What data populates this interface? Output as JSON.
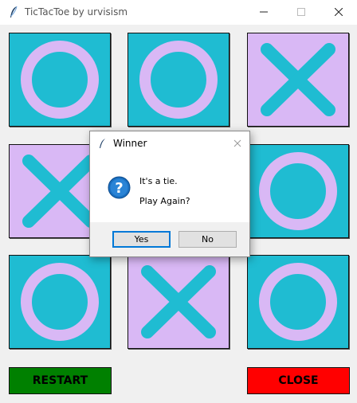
{
  "window": {
    "title": "TicTacToe by urvisism"
  },
  "board": {
    "cells": [
      "O",
      "O",
      "X",
      "X",
      "",
      "O",
      "O",
      "X",
      "O"
    ],
    "colors": {
      "cyan": "#1fbcd2",
      "lavender": "#d9b8f5"
    }
  },
  "buttons": {
    "restart": "RESTART",
    "close": "CLOSE"
  },
  "dialog": {
    "title": "Winner",
    "message_line1": "It's a tie.",
    "message_line2": "Play Again?",
    "yes": "Yes",
    "no": "No",
    "icon": "question-icon"
  }
}
